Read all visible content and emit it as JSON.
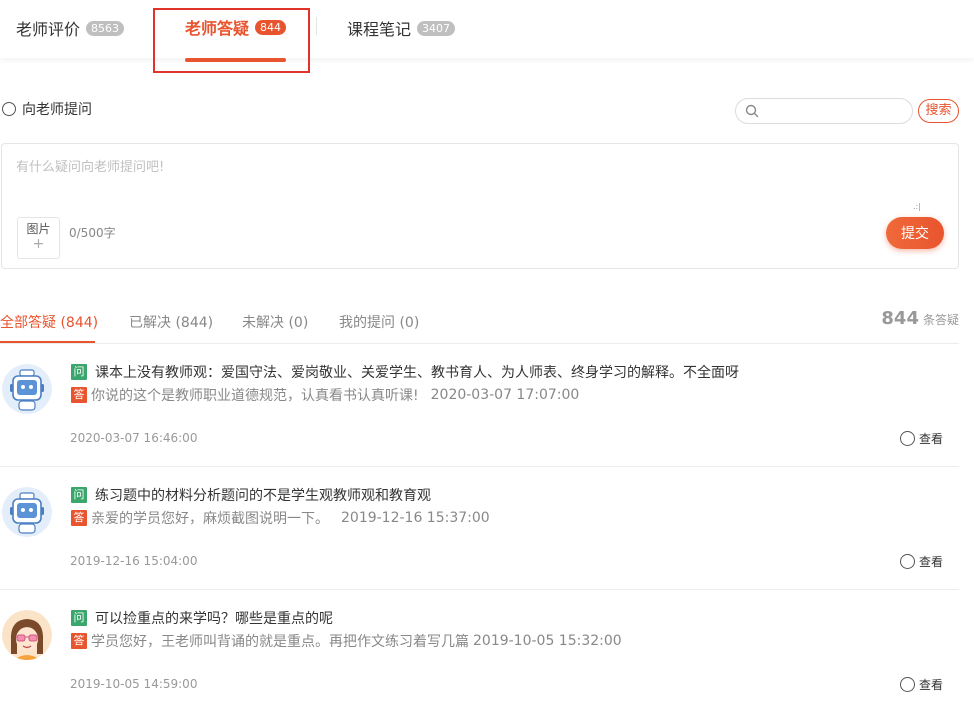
{
  "top_tabs": [
    {
      "label": "老师评价",
      "count": "8563"
    },
    {
      "label": "老师答疑",
      "count": "844"
    },
    {
      "label": "课程笔记",
      "count": "3407"
    }
  ],
  "ask": {
    "label": "向老师提问",
    "search_button": "搜索",
    "placeholder": "有什么疑问向老师提问吧!",
    "image_button": "图片",
    "image_plus": "+",
    "counter": "0/500字",
    "submit": "提交"
  },
  "filters": [
    {
      "label": "全部答疑 (844)"
    },
    {
      "label": "已解决 (844)"
    },
    {
      "label": "未解决 (0)"
    },
    {
      "label": "我的提问 (0)"
    }
  ],
  "total": {
    "number": "844",
    "unit": "条答疑"
  },
  "tags": {
    "question": "问",
    "answer": "答"
  },
  "view_label": "查看",
  "items": [
    {
      "question": "课本上没有教师观：爱国守法、爱岗敬业、关爱学生、教书育人、为人师表、终身学习的解释。不全面呀",
      "answer": "你说的这个是教师职业道德规范，认真看书认真听课!",
      "answer_time": "2020-03-07 17:07:00",
      "time": "2020-03-07 16:46:00",
      "avatar": "robot-avatar"
    },
    {
      "question": "练习题中的材料分析题问的不是学生观教师观和教育观",
      "answer": "亲爱的学员您好，麻烦截图说明一下。",
      "answer_time": "2019-12-16 15:37:00",
      "time": "2019-12-16 15:04:00",
      "avatar": "robot-avatar"
    },
    {
      "question": "可以捡重点的来学吗？哪些是重点的呢",
      "answer": "学员您好，王老师叫背诵的就是重点。再把作文练习着写几篇",
      "answer_time": "2019-10-05 15:32:00",
      "time": "2019-10-05 14:59:00",
      "avatar": "girl-avatar"
    }
  ],
  "colors": {
    "accent": "#e8542e",
    "question_tag": "#3aa66c",
    "highlight": "#e0342a"
  }
}
